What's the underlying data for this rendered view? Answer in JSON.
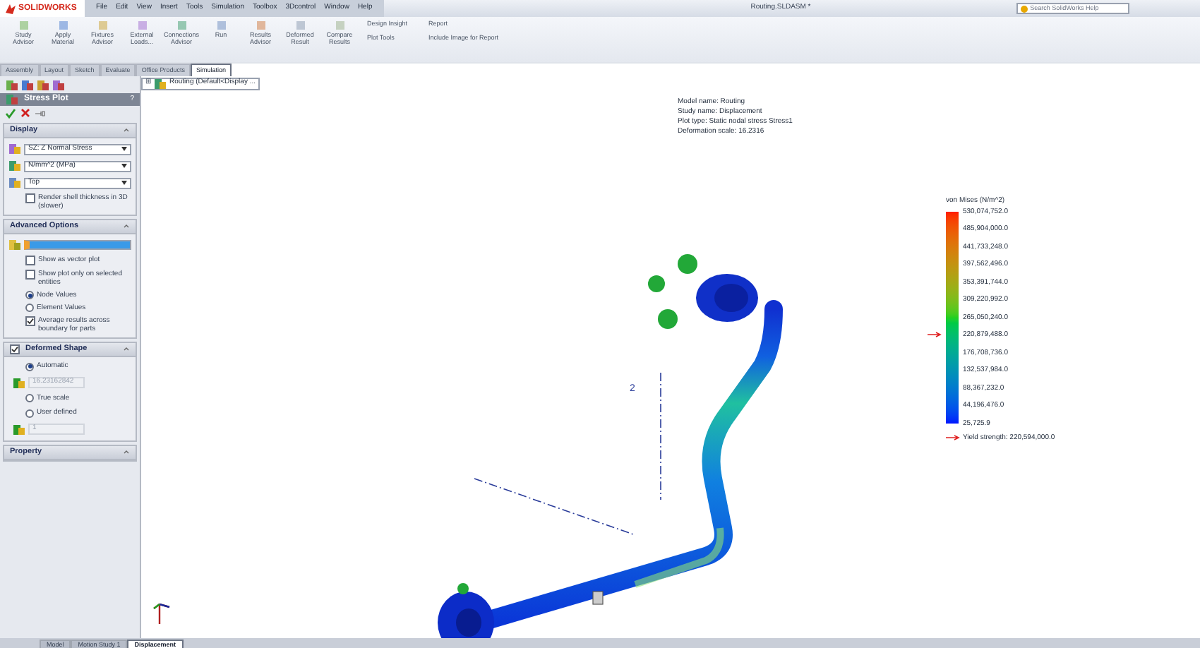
{
  "app": {
    "logo": "SOLIDWORKS",
    "title": "Routing.SLDASM *",
    "search_placeholder": "Search SolidWorks Help"
  },
  "menu": [
    "File",
    "Edit",
    "View",
    "Insert",
    "Tools",
    "Simulation",
    "Toolbox",
    "3Dcontrol",
    "Window",
    "Help"
  ],
  "ribbon": {
    "large_buttons": [
      {
        "label": "Study Advisor"
      },
      {
        "label": "Apply Material"
      },
      {
        "label": "Fixtures Advisor"
      },
      {
        "label": "External Loads..."
      },
      {
        "label": "Connections Advisor"
      },
      {
        "label": "Run"
      },
      {
        "label": "Results Advisor"
      },
      {
        "label": "Deformed Result"
      },
      {
        "label": "Compare Results"
      }
    ],
    "small_buttons": [
      {
        "label": "Design Insight"
      },
      {
        "label": "Plot Tools"
      },
      {
        "label": "Report"
      },
      {
        "label": "Include Image for Report"
      }
    ]
  },
  "tabs": [
    {
      "label": "Assembly",
      "selected": false
    },
    {
      "label": "Layout",
      "selected": false
    },
    {
      "label": "Sketch",
      "selected": false
    },
    {
      "label": "Evaluate",
      "selected": false
    },
    {
      "label": "Office Products",
      "selected": false
    },
    {
      "label": "Simulation",
      "selected": true
    }
  ],
  "tree": {
    "expander": "⊞",
    "label": "Routing  (Default<Display ..."
  },
  "panel": {
    "title": "Stress Plot",
    "help": "?",
    "display": {
      "title": "Display",
      "dropdowns": [
        "SZ: Z Normal Stress",
        "N/mm^2 (MPa)",
        "Top"
      ],
      "checkbox": {
        "label": "Render shell thickness in 3D (slower)",
        "checked": false
      }
    },
    "advanced": {
      "title": "Advanced Options",
      "options": [
        {
          "kind": "checkbox",
          "label": "Show as vector plot",
          "checked": false
        },
        {
          "kind": "checkbox",
          "label": "Show plot only on selected entities",
          "checked": false
        },
        {
          "kind": "radio",
          "label": "Node Values",
          "checked": true
        },
        {
          "kind": "radio",
          "label": "Element Values",
          "checked": false
        },
        {
          "kind": "checkbox",
          "label": "Average results across boundary for parts",
          "checked": true
        }
      ]
    },
    "deformed": {
      "title": "Deformed Shape",
      "checked": true,
      "options": [
        {
          "kind": "radio",
          "label": "Automatic",
          "checked": true
        },
        {
          "kind": "field",
          "value": "16.23162842"
        },
        {
          "kind": "radio",
          "label": "True scale",
          "checked": false
        },
        {
          "kind": "radio",
          "label": "User defined",
          "checked": false
        },
        {
          "kind": "field",
          "value": "1"
        }
      ]
    },
    "property": {
      "title": "Property"
    }
  },
  "viewport": {
    "info": [
      "Model name: Routing",
      "Study name: Displacement",
      "Plot type: Static nodal stress Stress1",
      "Deformation scale: 16.2316"
    ],
    "model_labels": [
      "2"
    ],
    "legend": {
      "title": "von Mises (N/m^2)",
      "labels": [
        {
          "value": "530,074,752.0",
          "marker": false
        },
        {
          "value": "485,904,000.0",
          "marker": false
        },
        {
          "value": "441,733,248.0",
          "marker": false
        },
        {
          "value": "397,562,496.0",
          "marker": false
        },
        {
          "value": "353,391,744.0",
          "marker": false
        },
        {
          "value": "309,220,992.0",
          "marker": false
        },
        {
          "value": "265,050,240.0",
          "marker": false
        },
        {
          "value": "220,879,488.0",
          "marker": true
        },
        {
          "value": "176,708,736.0",
          "marker": false
        },
        {
          "value": "132,537,984.0",
          "marker": false
        },
        {
          "value": "88,367,232.0",
          "marker": false
        },
        {
          "value": "44,196,476.0",
          "marker": false
        },
        {
          "value": "25,725.9",
          "marker": false
        }
      ],
      "yield_label": "Yield strength: 220,594,000.0"
    }
  },
  "bottom_tabs": [
    {
      "label": "Model",
      "selected": false
    },
    {
      "label": "Motion Study 1",
      "selected": false
    },
    {
      "label": "Displacement",
      "selected": true
    }
  ]
}
